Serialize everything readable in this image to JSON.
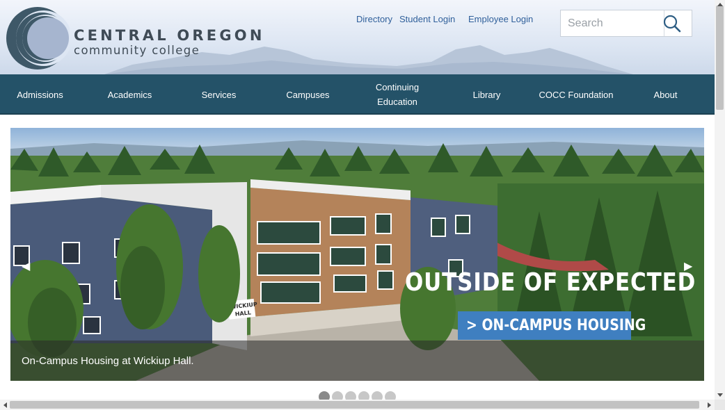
{
  "header": {
    "logo_line1": "CENTRAL OREGON",
    "logo_line2": "community college",
    "links": [
      "Directory",
      "Student Login",
      "Employee Login"
    ],
    "search_placeholder": "Search"
  },
  "nav": {
    "items": [
      "Admissions",
      "Academics",
      "Services",
      "Campuses",
      "Continuing Education",
      "Library",
      "COCC Foundation",
      "About"
    ]
  },
  "slider": {
    "promo_headline": "OUTSIDE OF EXPECTED",
    "promo_button": "> ON-CAMPUS HOUSING",
    "building_sign": "WICKIUP HALL",
    "caption": "On-Campus Housing at Wickiup Hall.",
    "prev_arrow": "◀",
    "next_arrow": "▶",
    "slide_count": 6,
    "active_slide": 1
  },
  "icons": {
    "logo": "cocc-logo-icon",
    "search": "search-icon",
    "prev": "arrow-left-icon",
    "next": "arrow-right-icon"
  },
  "colors": {
    "nav_bg": "#245268",
    "header_bg": "#dde6f3",
    "link": "#2f5f9a",
    "promo_button": "#3f7fc0"
  }
}
